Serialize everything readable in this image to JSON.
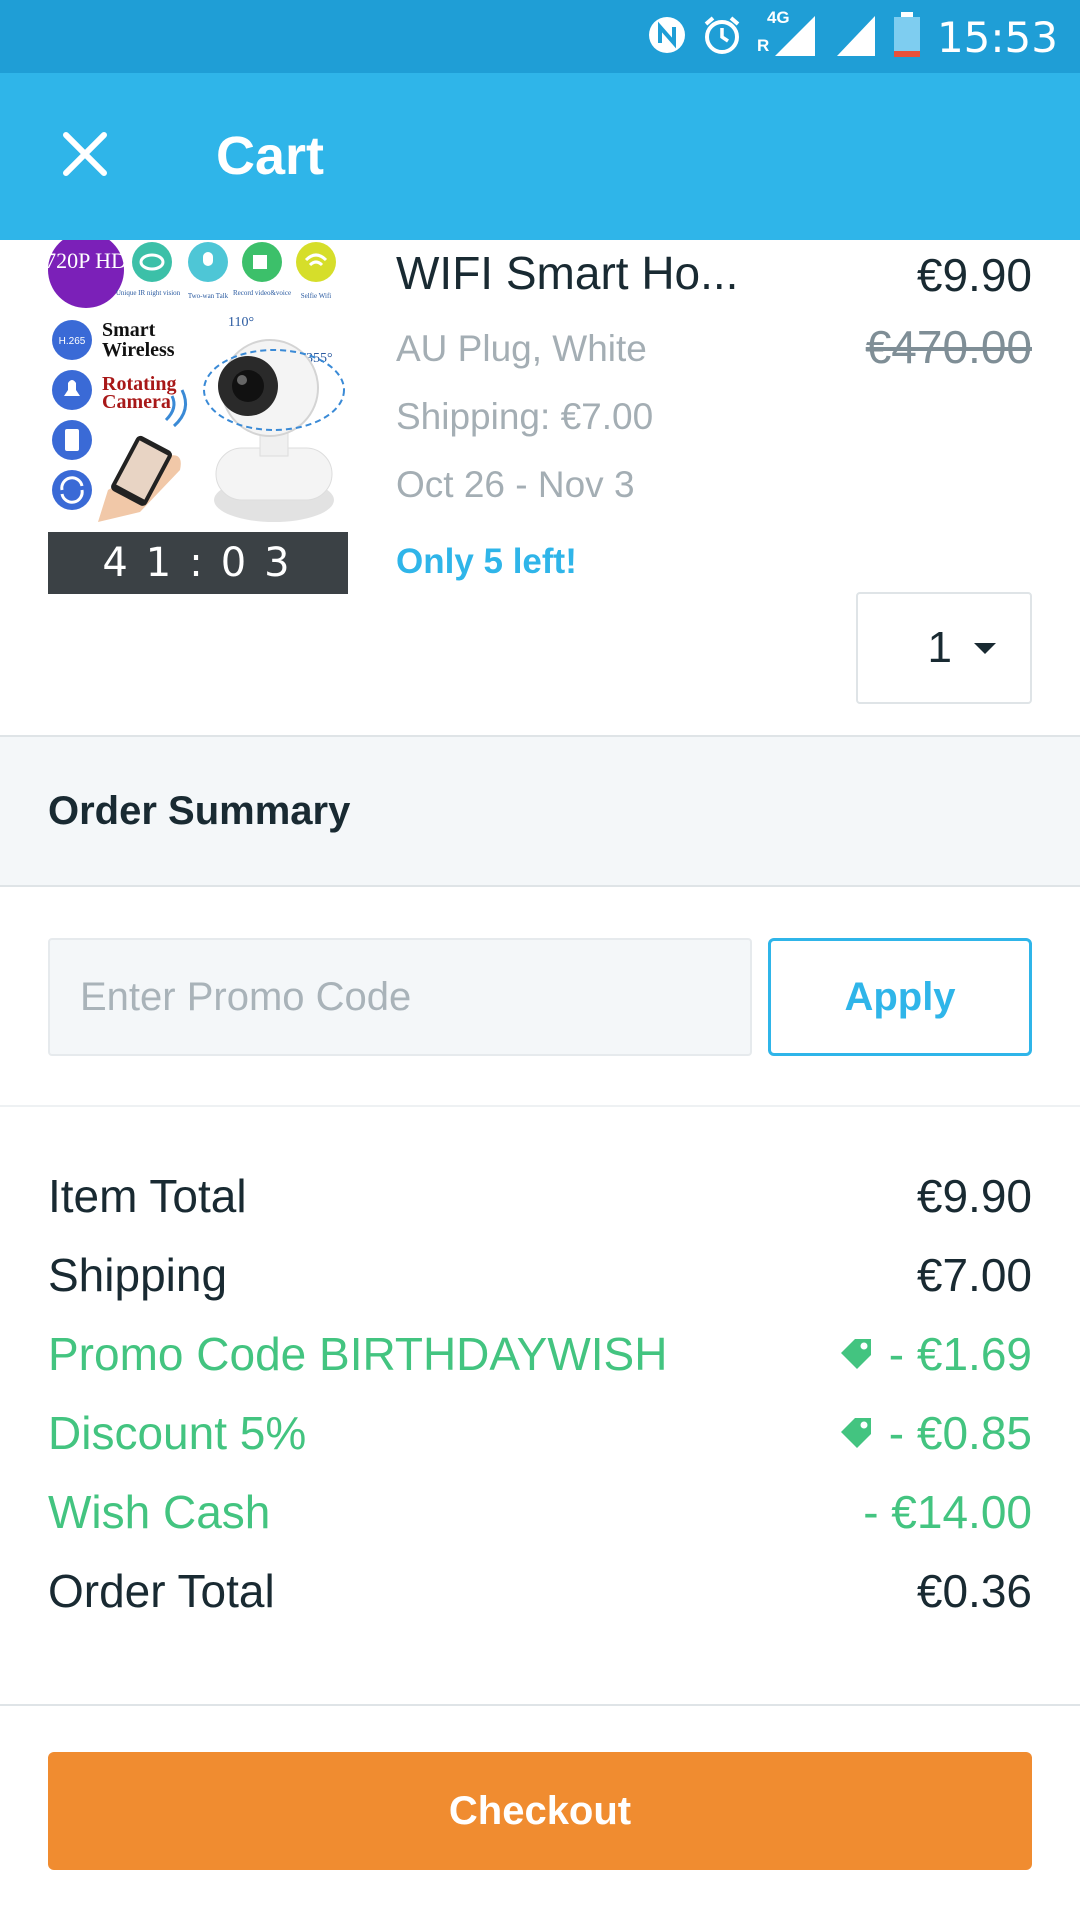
{
  "status_bar": {
    "time": "15:53",
    "network": "4G",
    "roaming": "R"
  },
  "header": {
    "title": "Cart"
  },
  "product": {
    "name": "WIFI Smart Ho...",
    "price": "€9.90",
    "original_price": "€470.00",
    "variant": "AU Plug, White",
    "shipping": "Shipping: €7.00",
    "delivery": "Oct 26 - Nov 3",
    "stock": "Only 5 left!",
    "timer": "41:03",
    "quantity": "1",
    "image_text": {
      "badge": "720P HD",
      "codec": "H.265",
      "line1": "Smart",
      "line2": "Wireless",
      "line3": "Rotating",
      "line4": "Camera",
      "angle1": "110°",
      "angle2": "355°",
      "feat1": "Unique IR night vision",
      "feat2": "Two-wan Talk",
      "feat3": "Record video&voice",
      "feat4": "Selfie Wifi"
    }
  },
  "summary": {
    "title": "Order Summary"
  },
  "promo": {
    "placeholder": "Enter Promo Code",
    "apply_label": "Apply"
  },
  "totals": [
    {
      "label": "Item Total",
      "value": "€9.90",
      "green": false,
      "tag": false
    },
    {
      "label": "Shipping",
      "value": "€7.00",
      "green": false,
      "tag": false
    },
    {
      "label": "Promo Code BIRTHDAYWISH",
      "value": "- €1.69",
      "green": true,
      "tag": true
    },
    {
      "label": "Discount 5%",
      "value": "- €0.85",
      "green": true,
      "tag": true
    },
    {
      "label": "Wish Cash",
      "value": "- €14.00",
      "green": true,
      "tag": false
    },
    {
      "label": "Order Total",
      "value": "€0.36",
      "green": false,
      "tag": false
    }
  ],
  "checkout_label": "Checkout",
  "colors": {
    "status_bar": "#1f9ed6",
    "app_bar": "#2fb5e9",
    "accent": "#2fb5e9",
    "green": "#43c480",
    "checkout": "#f08c30"
  }
}
